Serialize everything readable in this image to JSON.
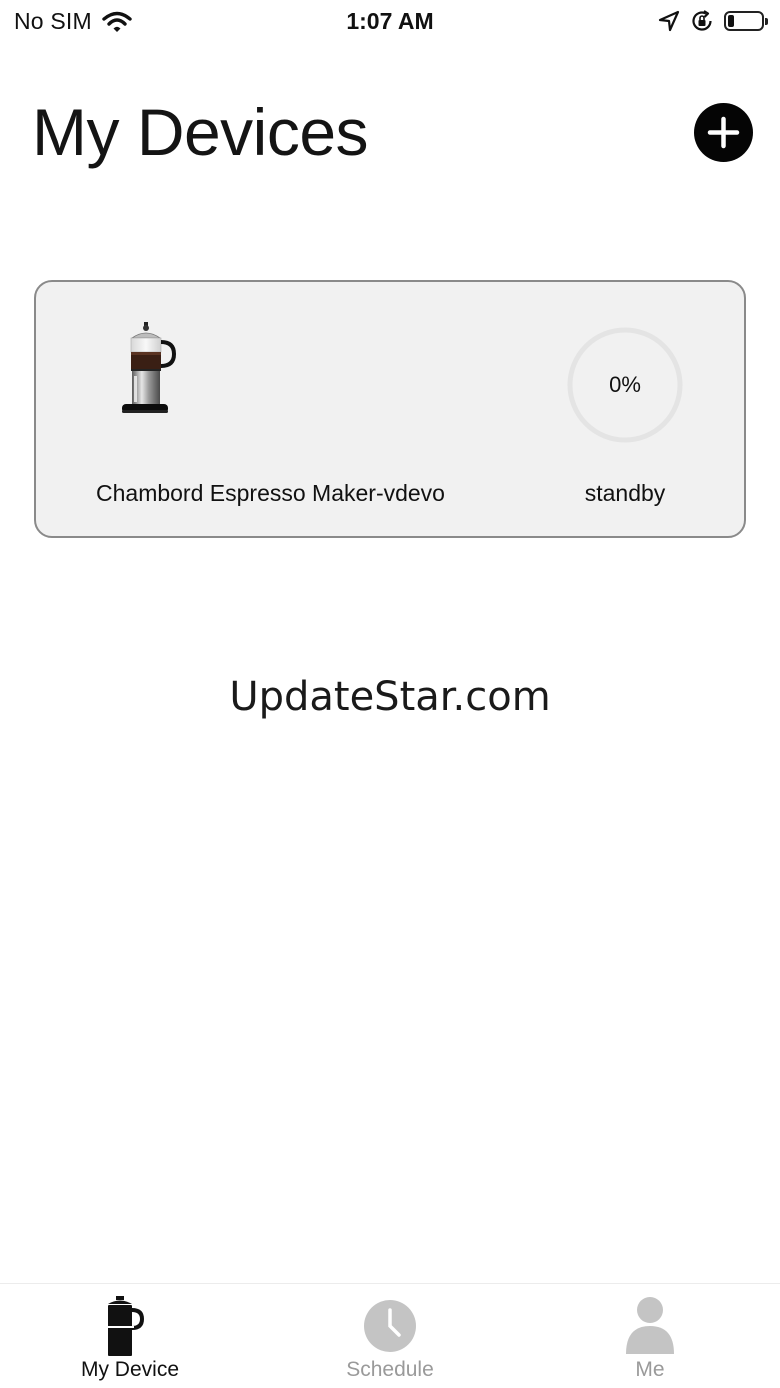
{
  "status_bar": {
    "carrier": "No SIM",
    "time": "1:07 AM",
    "battery_level": 0.2
  },
  "header": {
    "title": "My Devices"
  },
  "devices": [
    {
      "name": "Chambord Espresso Maker-vdevo",
      "progress_label": "0%",
      "progress": 0,
      "status": "standby"
    }
  ],
  "watermark": "UpdateStar.com",
  "tabs": [
    {
      "label": "My Device",
      "icon": "coffee-pot-icon",
      "active": true
    },
    {
      "label": "Schedule",
      "icon": "clock-icon",
      "active": false
    },
    {
      "label": "Me",
      "icon": "user-icon",
      "active": false
    }
  ],
  "colors": {
    "active_tab": "#111111",
    "inactive_tab": "#9a9a9a",
    "card_background": "#f1f1f1",
    "card_border": "#8a8a8a",
    "ring_track": "#e4e4e4"
  }
}
